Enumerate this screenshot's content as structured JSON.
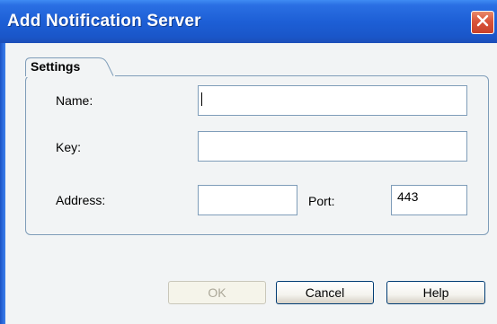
{
  "window": {
    "title": "Add Notification Server"
  },
  "settings": {
    "group_label": "Settings",
    "name": {
      "label": "Name:",
      "value": ""
    },
    "key": {
      "label": "Key:",
      "value": ""
    },
    "address": {
      "label": "Address:",
      "value": ""
    },
    "port": {
      "label": "Port:",
      "value": "443"
    }
  },
  "buttons": {
    "ok": "OK",
    "cancel": "Cancel",
    "help": "Help"
  },
  "colors": {
    "titlebar": "#1d5fd6",
    "close_button": "#d9533a",
    "border": "#7f9db9"
  },
  "icons": {
    "close": "close-icon"
  }
}
